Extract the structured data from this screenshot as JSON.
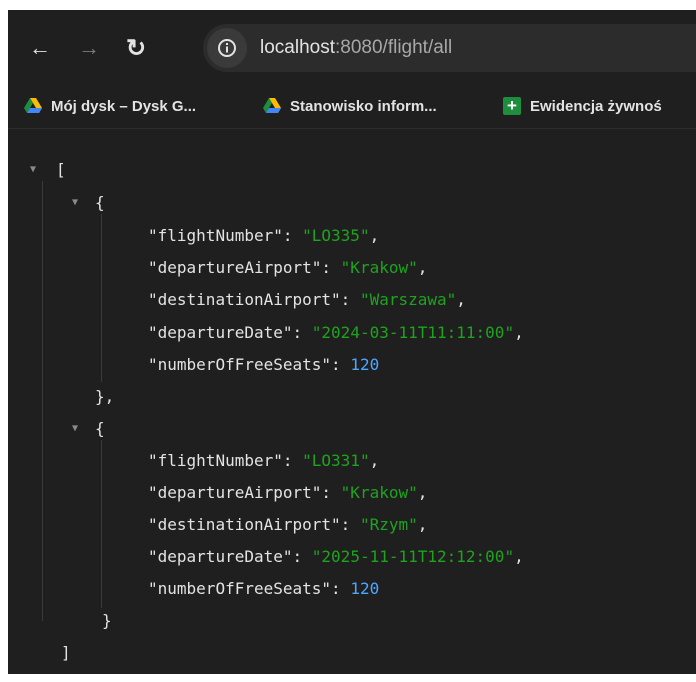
{
  "toolbar": {
    "back_icon": "←",
    "forward_icon": "→",
    "reload_icon": "↻",
    "url_host": "localhost",
    "url_rest": ":8080/flight/all"
  },
  "bookmarks": [
    {
      "label": "Mój dysk – Dysk G...",
      "icon": "google-drive-icon"
    },
    {
      "label": "Stanowisko inform...",
      "icon": "google-drive-icon"
    },
    {
      "label": "Ewidencja żywnoś",
      "icon": "green-plus-icon"
    }
  ],
  "json": {
    "open_array": "[",
    "close_array": "]",
    "open_obj": "{",
    "close_obj_comma": "},",
    "close_obj": "}",
    "flights": [
      {
        "lines": [
          {
            "key": "flightNumber",
            "value": "\"LO335\"",
            "type": "str"
          },
          {
            "key": "departureAirport",
            "value": "\"Krakow\"",
            "type": "str"
          },
          {
            "key": "destinationAirport",
            "value": "\"Warszawa\"",
            "type": "str"
          },
          {
            "key": "departureDate",
            "value": "\"2024-03-11T11:11:00\"",
            "type": "str"
          },
          {
            "key": "numberOfFreeSeats",
            "value": "120",
            "type": "num"
          }
        ]
      },
      {
        "lines": [
          {
            "key": "flightNumber",
            "value": "\"LO331\"",
            "type": "str"
          },
          {
            "key": "departureAirport",
            "value": "\"Krakow\"",
            "type": "str"
          },
          {
            "key": "destinationAirport",
            "value": "\"Rzym\"",
            "type": "str"
          },
          {
            "key": "departureDate",
            "value": "\"2025-11-11T12:12:00\"",
            "type": "str"
          },
          {
            "key": "numberOfFreeSeats",
            "value": "120",
            "type": "num"
          }
        ]
      }
    ]
  },
  "colors": {
    "background": "#1f1f1f",
    "string": "#1ea31e",
    "number": "#4aa8ff",
    "text": "#e3e3e3"
  }
}
